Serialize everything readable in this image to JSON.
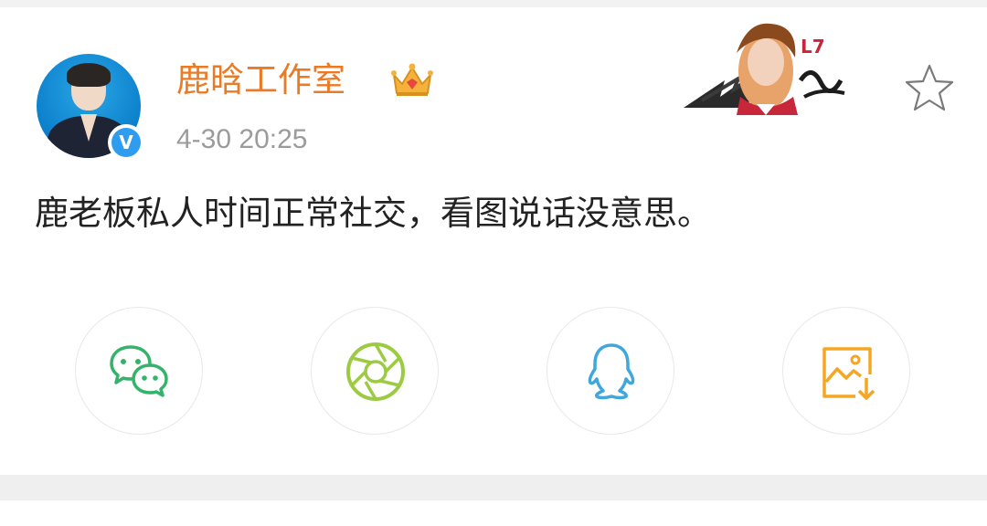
{
  "post": {
    "author": "鹿晗工作室",
    "badge_icon": "crown-icon",
    "timestamp": "4-30 20:25",
    "text": "鹿老板私人时间正常社交，看图说话没意思。",
    "verified_icon": "verified-v-icon",
    "verified_label": "V",
    "favorite_icon": "star-outline-icon"
  },
  "share": {
    "buttons": [
      {
        "name": "share-wechat",
        "icon": "wechat-icon",
        "color": "#34b36a"
      },
      {
        "name": "share-moments",
        "icon": "moments-aperture-icon",
        "color": "#9ccb43"
      },
      {
        "name": "share-qq",
        "icon": "qq-penguin-icon",
        "color": "#3fa7dc"
      },
      {
        "name": "save-image",
        "icon": "save-image-icon",
        "color": "#f5a623"
      }
    ]
  },
  "colors": {
    "author_name": "#eb7a25",
    "timestamp": "#9b9b9b",
    "verify_badge": "#2e9df0",
    "text": "#222222"
  }
}
